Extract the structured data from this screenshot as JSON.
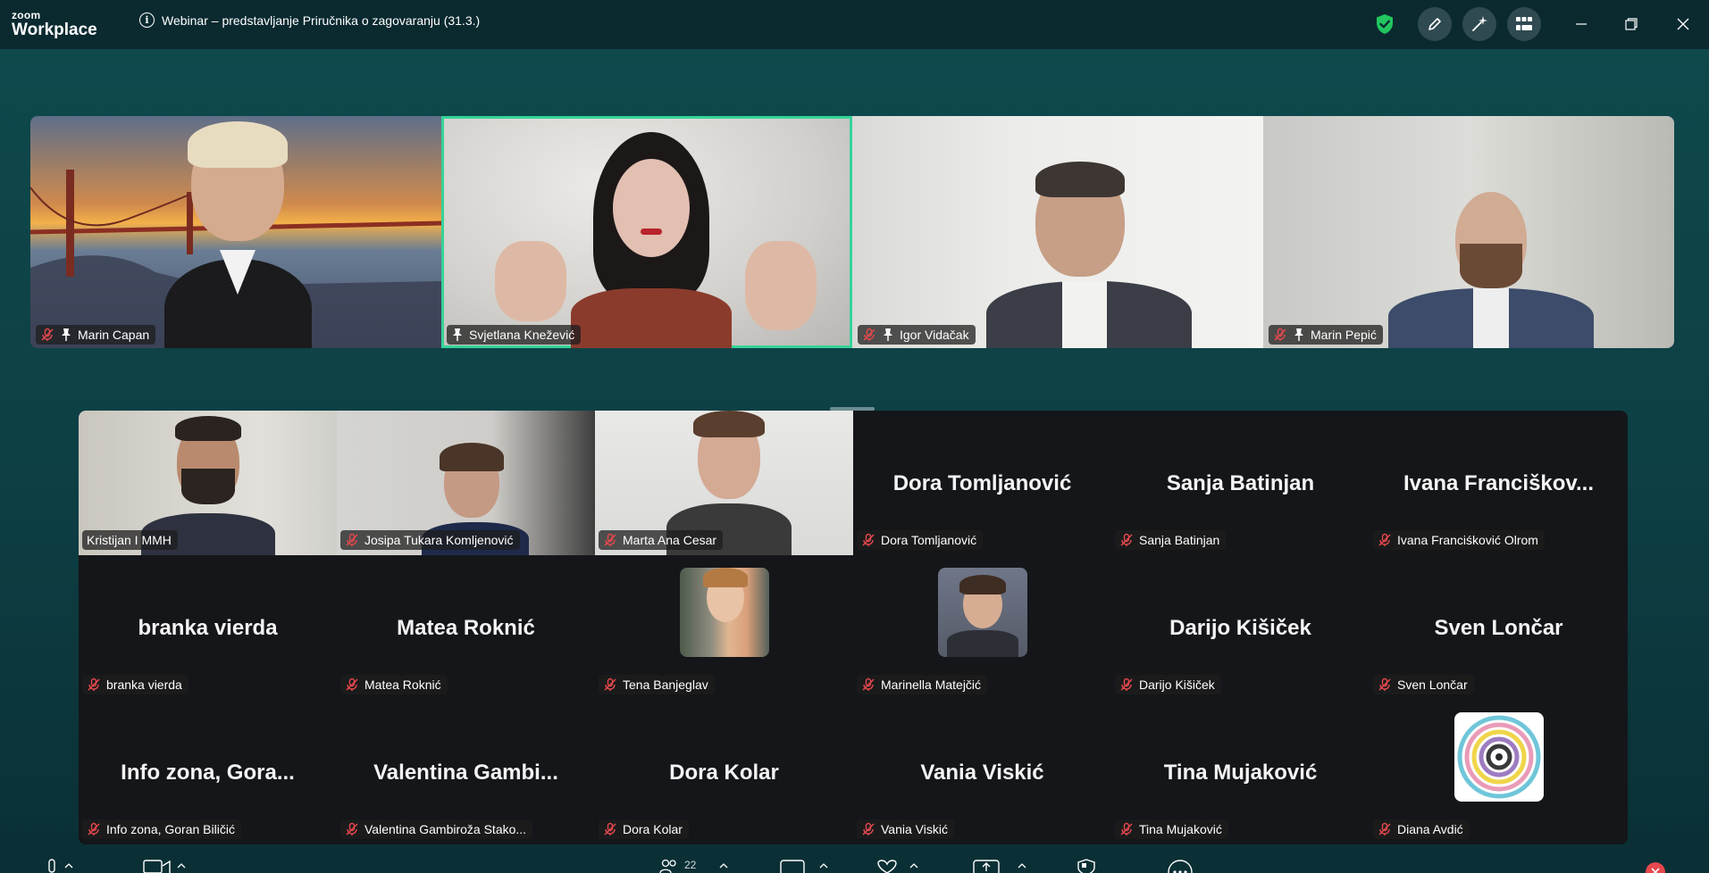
{
  "app": {
    "brand_top": "zoom",
    "brand_bottom": "Workplace"
  },
  "window": {
    "title": "Webinar – predstavljanje Priručnika o zagovaranju (31.3.)"
  },
  "speakers": [
    {
      "name": "Marin Capan",
      "muted": true,
      "pinned": true
    },
    {
      "name": "Svjetlana Knežević",
      "muted": false,
      "pinned": true,
      "active": true
    },
    {
      "name": "Igor Vidačak",
      "muted": true,
      "pinned": true
    },
    {
      "name": "Marin Pepić",
      "muted": true,
      "pinned": true
    }
  ],
  "gallery": [
    {
      "name": "Kristijan I MMH",
      "video": true,
      "muted": false
    },
    {
      "name": "Josipa Tukara Komljenović",
      "video": true,
      "muted": true
    },
    {
      "name": "Marta Ana Cesar",
      "video": true,
      "muted": true
    },
    {
      "name": "Dora Tomljanović",
      "display": "Dora Tomljanović",
      "muted": true
    },
    {
      "name": "Sanja Batinjan",
      "display": "Sanja Batinjan",
      "muted": true
    },
    {
      "name": "Ivana Franciśković Olrom",
      "display": "Ivana  Franciškov...",
      "muted": true
    },
    {
      "name": "branka vierda",
      "display": "branka vierda",
      "muted": true
    },
    {
      "name": "Matea Roknić",
      "display": "Matea Roknić",
      "muted": true
    },
    {
      "name": "Tena Banjeglav",
      "avatar": true,
      "muted": true
    },
    {
      "name": "Marinella Matejčić",
      "avatar": true,
      "muted": true
    },
    {
      "name": "Darijo Kišiček",
      "display": "Darijo Kišiček",
      "muted": true
    },
    {
      "name": "Sven Lončar",
      "display": "Sven Lončar",
      "muted": true
    },
    {
      "name": "Info zona, Goran Biličić",
      "display": "Info  zona,  Gora...",
      "muted": true
    },
    {
      "name": "Valentina Gambiroža Stako...",
      "display": "Valentina  Gambi...",
      "muted": true
    },
    {
      "name": "Dora Kolar",
      "display": "Dora Kolar",
      "muted": true
    },
    {
      "name": "Vania Viskić",
      "display": "Vania Viskić",
      "muted": true
    },
    {
      "name": "Tina Mujaković",
      "display": "Tina Mujaković",
      "muted": true
    },
    {
      "name": "Diana Avdić",
      "avatar": true,
      "muted": true
    }
  ],
  "toolbar": {
    "participants_count": "22"
  },
  "colors": {
    "active_speaker": "#35d399",
    "muted_red": "#e5484d",
    "shield_green": "#22c55e"
  },
  "icons": [
    "info-icon",
    "shield-icon",
    "annotate-icon",
    "ai-companion-icon",
    "apps-icon",
    "minimize-icon",
    "restore-icon",
    "close-icon",
    "mic-muted-icon",
    "pin-icon",
    "microphone-icon",
    "video-icon",
    "participants-icon",
    "chat-icon",
    "react-icon",
    "share-icon",
    "security-icon",
    "more-icon"
  ]
}
